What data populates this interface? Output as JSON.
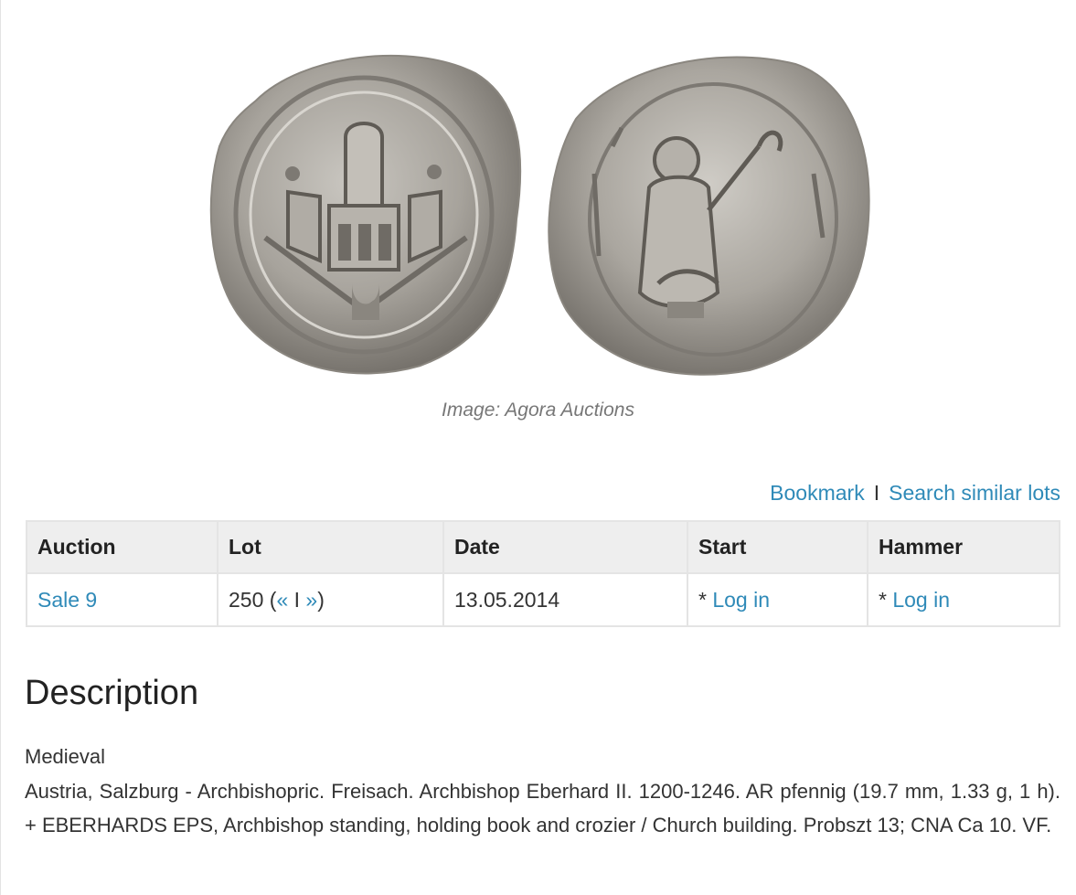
{
  "image": {
    "caption": "Image: Agora Auctions"
  },
  "actions": {
    "bookmark": "Bookmark",
    "separator": "I",
    "search_similar": "Search similar lots"
  },
  "table": {
    "headers": [
      "Auction",
      "Lot",
      "Date",
      "Start",
      "Hammer"
    ],
    "row": {
      "auction": "Sale 9",
      "lot_number": "250",
      "lot_open_paren": " (",
      "prev": "«",
      "nav_sep": " I ",
      "next": "»",
      "lot_close_paren": ")",
      "date": "13.05.2014",
      "start_prefix": "* ",
      "start_link": "Log in",
      "hammer_prefix": "* ",
      "hammer_link": "Log in"
    }
  },
  "description": {
    "heading": "Description",
    "category": "Medieval",
    "text": "Austria, Salzburg - Archbishopric. Freisach. Archbishop Eberhard II. 1200-1246. AR pfennig (19.7 mm, 1.33 g, 1 h). + EBERHARDS EPS, Archbishop standing, holding book and crozier / Church building. Probszt 13; CNA Ca 10. VF."
  }
}
